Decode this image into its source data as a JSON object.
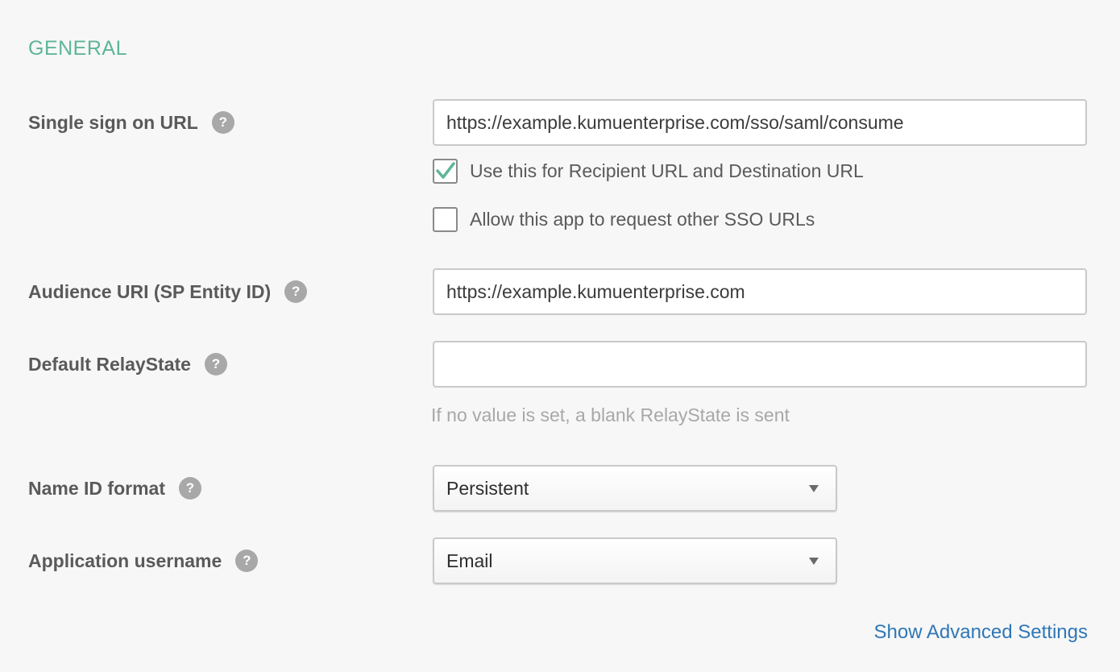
{
  "section": {
    "title": "GENERAL"
  },
  "fields": {
    "sso_url": {
      "label": "Single sign on URL",
      "value": "https://example.kumuenterprise.com/sso/saml/consume"
    },
    "recipient_checkbox": {
      "label": "Use this for Recipient URL and Destination URL",
      "checked": true
    },
    "allow_sso_checkbox": {
      "label": "Allow this app to request other SSO URLs",
      "checked": false
    },
    "audience_uri": {
      "label": "Audience URI (SP Entity ID)",
      "value": "https://example.kumuenterprise.com"
    },
    "relay_state": {
      "label": "Default RelayState",
      "value": "",
      "hint": "If no value is set, a blank RelayState is sent"
    },
    "name_id_format": {
      "label": "Name ID format",
      "selected": "Persistent"
    },
    "app_username": {
      "label": "Application username",
      "selected": "Email"
    }
  },
  "help_glyph": "?",
  "advanced_link": "Show Advanced Settings",
  "colors": {
    "accent": "#5eb59a",
    "link": "#2f77b7",
    "background": "#f7f7f7"
  },
  "icons": [
    "help-icon",
    "checkmark-icon",
    "caret-down-icon"
  ]
}
